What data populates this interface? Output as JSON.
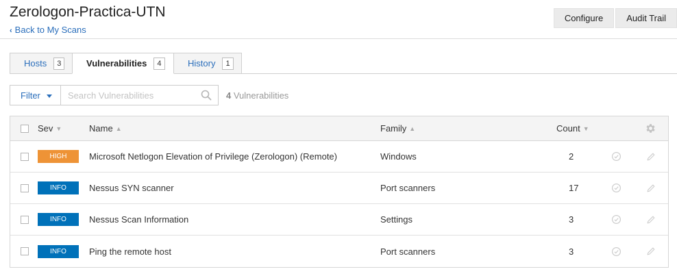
{
  "header": {
    "title": "Zerologon-Practica-UTN",
    "back_label": "Back to My Scans",
    "configure_label": "Configure",
    "audit_trail_label": "Audit Trail"
  },
  "tabs": [
    {
      "label": "Hosts",
      "count": "3",
      "active": false
    },
    {
      "label": "Vulnerabilities",
      "count": "4",
      "active": true
    },
    {
      "label": "History",
      "count": "1",
      "active": false
    }
  ],
  "filter": {
    "filter_label": "Filter",
    "search_placeholder": "Search Vulnerabilities",
    "search_value": "",
    "result_count": "4",
    "result_label": "Vulnerabilities"
  },
  "table": {
    "columns": {
      "sev": "Sev",
      "name": "Name",
      "family": "Family",
      "count": "Count"
    },
    "rows": [
      {
        "severity": "HIGH",
        "severity_color": "#ee9336",
        "name": "Microsoft Netlogon Elevation of Privilege (Zerologon) (Remote)",
        "family": "Windows",
        "count": "2"
      },
      {
        "severity": "INFO",
        "severity_color": "#0071b9",
        "name": "Nessus SYN scanner",
        "family": "Port scanners",
        "count": "17"
      },
      {
        "severity": "INFO",
        "severity_color": "#0071b9",
        "name": "Nessus Scan Information",
        "family": "Settings",
        "count": "3"
      },
      {
        "severity": "INFO",
        "severity_color": "#0071b9",
        "name": "Ping the remote host",
        "family": "Port scanners",
        "count": "3"
      }
    ]
  },
  "icons": {
    "back": "chevron-left-icon",
    "filter_caret": "caret-down-icon",
    "search": "search-icon",
    "settings": "gear-icon",
    "row_accept": "check-circle-icon",
    "row_edit": "pencil-icon"
  },
  "colors": {
    "link": "#2a6ebb",
    "high": "#ee9336",
    "info": "#0071b9"
  }
}
